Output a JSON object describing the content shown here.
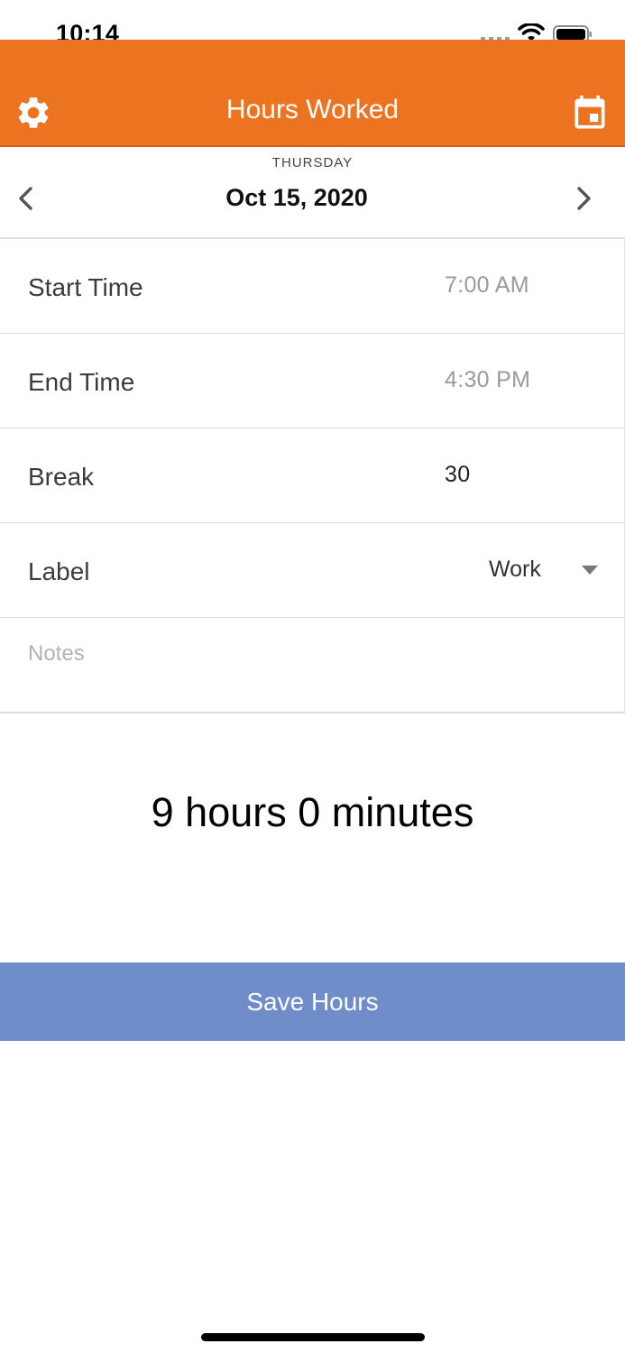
{
  "status_bar": {
    "time": "10:14"
  },
  "header": {
    "title": "Hours Worked",
    "left_icon": "gear-icon",
    "right_icon": "calendar-icon",
    "background": "#ec7420"
  },
  "date_nav": {
    "weekday": "THURSDAY",
    "date": "Oct 15, 2020",
    "prev_icon": "chevron-left-icon",
    "next_icon": "chevron-right-icon"
  },
  "form": {
    "start_time": {
      "label": "Start Time",
      "value": "7:00 AM"
    },
    "end_time": {
      "label": "End Time",
      "value": "4:30 PM"
    },
    "break": {
      "label": "Break",
      "value": "30"
    },
    "label": {
      "label": "Label",
      "value": "Work",
      "icon": "caret-down-icon"
    },
    "notes": {
      "placeholder": "Notes"
    }
  },
  "summary": {
    "total": "9 hours 0 minutes"
  },
  "save_button": {
    "label": "Save Hours",
    "background": "#6e8dc9"
  }
}
